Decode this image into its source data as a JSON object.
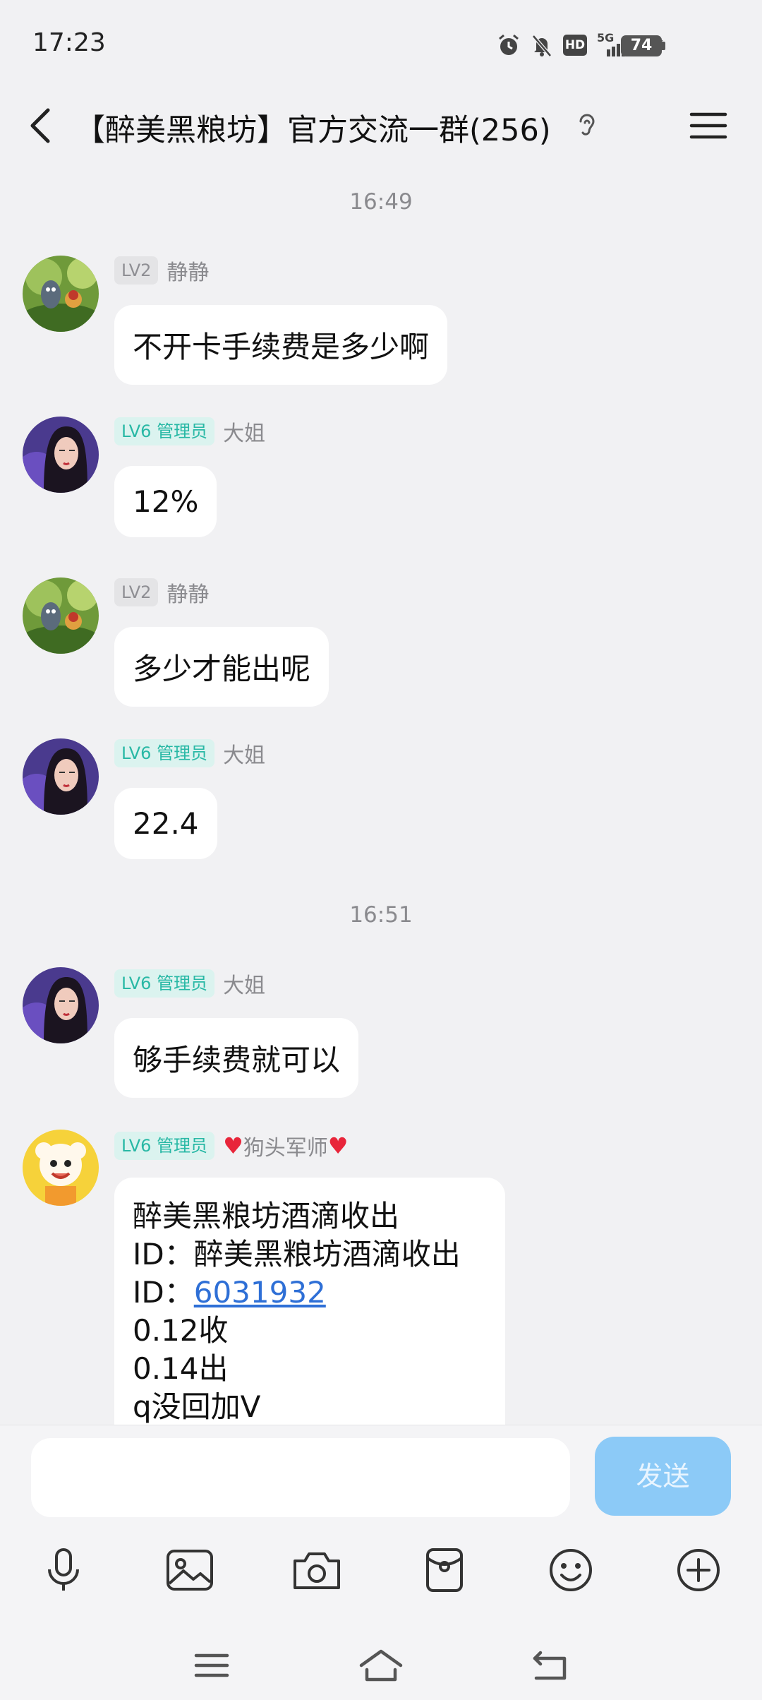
{
  "status_bar": {
    "time": "17:23",
    "network": "5G",
    "hd": "HD",
    "battery": "74",
    "icons": [
      "alarm-icon",
      "mute-icon",
      "hd-icon",
      "signal-icon",
      "wifi-icon",
      "battery-icon"
    ]
  },
  "header": {
    "title": "【醉美黑粮坊】官方交流一群(256)",
    "icons": [
      "back-arrow-icon",
      "ear-icon",
      "menu-icon"
    ]
  },
  "messages": [
    {
      "type": "timestamp",
      "text": "16:49"
    },
    {
      "type": "message",
      "level": "LV2",
      "role": "",
      "sender": "静静",
      "text": "不开卡手续费是多少啊"
    },
    {
      "type": "message",
      "level": "LV6",
      "role": "管理员",
      "sender": "大姐",
      "text": "12%"
    },
    {
      "type": "message",
      "level": "LV2",
      "role": "",
      "sender": "静静",
      "text": "多少才能出呢"
    },
    {
      "type": "message",
      "level": "LV6",
      "role": "管理员",
      "sender": "大姐",
      "text": "22.4"
    },
    {
      "type": "timestamp",
      "text": "16:51"
    },
    {
      "type": "message",
      "level": "LV6",
      "role": "管理员",
      "sender": "大姐",
      "text": "够手续费就可以"
    },
    {
      "type": "message",
      "level": "LV6",
      "role": "管理员",
      "sender": "狗头军师",
      "lines": [
        "醉美黑粮坊酒滴收出",
        "ID：醉美黑粮坊酒滴收出",
        "ID：",
        "6031932",
        "0.12收",
        "0.14出",
        "q没回加V"
      ]
    }
  ],
  "composer": {
    "send_label": "发送",
    "tools": [
      "microphone-icon",
      "image-icon",
      "camera-icon",
      "red-packet-icon",
      "emoji-icon",
      "plus-icon"
    ]
  },
  "system_nav": [
    "menu-nav-icon",
    "home-nav-icon",
    "back-nav-icon"
  ],
  "colors": {
    "background": "#f1f1f3",
    "bubble": "#ffffff",
    "badge_lv6_bg": "#dbf3ef",
    "badge_lv6_text": "#28b8a5",
    "badge_lv2_bg": "#e4e4e6",
    "link": "#2e6fd6",
    "send_button": "#8ccaf7",
    "heart": "#e8253a"
  }
}
